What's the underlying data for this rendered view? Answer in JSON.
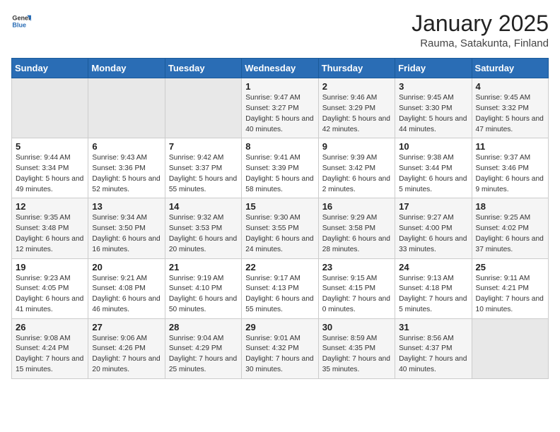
{
  "header": {
    "logo_general": "General",
    "logo_blue": "Blue",
    "title": "January 2025",
    "subtitle": "Rauma, Satakunta, Finland"
  },
  "weekdays": [
    "Sunday",
    "Monday",
    "Tuesday",
    "Wednesday",
    "Thursday",
    "Friday",
    "Saturday"
  ],
  "weeks": [
    [
      {
        "day": "",
        "sunrise": "",
        "sunset": "",
        "daylight": ""
      },
      {
        "day": "",
        "sunrise": "",
        "sunset": "",
        "daylight": ""
      },
      {
        "day": "",
        "sunrise": "",
        "sunset": "",
        "daylight": ""
      },
      {
        "day": "1",
        "sunrise": "Sunrise: 9:47 AM",
        "sunset": "Sunset: 3:27 PM",
        "daylight": "Daylight: 5 hours and 40 minutes."
      },
      {
        "day": "2",
        "sunrise": "Sunrise: 9:46 AM",
        "sunset": "Sunset: 3:29 PM",
        "daylight": "Daylight: 5 hours and 42 minutes."
      },
      {
        "day": "3",
        "sunrise": "Sunrise: 9:45 AM",
        "sunset": "Sunset: 3:30 PM",
        "daylight": "Daylight: 5 hours and 44 minutes."
      },
      {
        "day": "4",
        "sunrise": "Sunrise: 9:45 AM",
        "sunset": "Sunset: 3:32 PM",
        "daylight": "Daylight: 5 hours and 47 minutes."
      }
    ],
    [
      {
        "day": "5",
        "sunrise": "Sunrise: 9:44 AM",
        "sunset": "Sunset: 3:34 PM",
        "daylight": "Daylight: 5 hours and 49 minutes."
      },
      {
        "day": "6",
        "sunrise": "Sunrise: 9:43 AM",
        "sunset": "Sunset: 3:36 PM",
        "daylight": "Daylight: 5 hours and 52 minutes."
      },
      {
        "day": "7",
        "sunrise": "Sunrise: 9:42 AM",
        "sunset": "Sunset: 3:37 PM",
        "daylight": "Daylight: 5 hours and 55 minutes."
      },
      {
        "day": "8",
        "sunrise": "Sunrise: 9:41 AM",
        "sunset": "Sunset: 3:39 PM",
        "daylight": "Daylight: 5 hours and 58 minutes."
      },
      {
        "day": "9",
        "sunrise": "Sunrise: 9:39 AM",
        "sunset": "Sunset: 3:42 PM",
        "daylight": "Daylight: 6 hours and 2 minutes."
      },
      {
        "day": "10",
        "sunrise": "Sunrise: 9:38 AM",
        "sunset": "Sunset: 3:44 PM",
        "daylight": "Daylight: 6 hours and 5 minutes."
      },
      {
        "day": "11",
        "sunrise": "Sunrise: 9:37 AM",
        "sunset": "Sunset: 3:46 PM",
        "daylight": "Daylight: 6 hours and 9 minutes."
      }
    ],
    [
      {
        "day": "12",
        "sunrise": "Sunrise: 9:35 AM",
        "sunset": "Sunset: 3:48 PM",
        "daylight": "Daylight: 6 hours and 12 minutes."
      },
      {
        "day": "13",
        "sunrise": "Sunrise: 9:34 AM",
        "sunset": "Sunset: 3:50 PM",
        "daylight": "Daylight: 6 hours and 16 minutes."
      },
      {
        "day": "14",
        "sunrise": "Sunrise: 9:32 AM",
        "sunset": "Sunset: 3:53 PM",
        "daylight": "Daylight: 6 hours and 20 minutes."
      },
      {
        "day": "15",
        "sunrise": "Sunrise: 9:30 AM",
        "sunset": "Sunset: 3:55 PM",
        "daylight": "Daylight: 6 hours and 24 minutes."
      },
      {
        "day": "16",
        "sunrise": "Sunrise: 9:29 AM",
        "sunset": "Sunset: 3:58 PM",
        "daylight": "Daylight: 6 hours and 28 minutes."
      },
      {
        "day": "17",
        "sunrise": "Sunrise: 9:27 AM",
        "sunset": "Sunset: 4:00 PM",
        "daylight": "Daylight: 6 hours and 33 minutes."
      },
      {
        "day": "18",
        "sunrise": "Sunrise: 9:25 AM",
        "sunset": "Sunset: 4:02 PM",
        "daylight": "Daylight: 6 hours and 37 minutes."
      }
    ],
    [
      {
        "day": "19",
        "sunrise": "Sunrise: 9:23 AM",
        "sunset": "Sunset: 4:05 PM",
        "daylight": "Daylight: 6 hours and 41 minutes."
      },
      {
        "day": "20",
        "sunrise": "Sunrise: 9:21 AM",
        "sunset": "Sunset: 4:08 PM",
        "daylight": "Daylight: 6 hours and 46 minutes."
      },
      {
        "day": "21",
        "sunrise": "Sunrise: 9:19 AM",
        "sunset": "Sunset: 4:10 PM",
        "daylight": "Daylight: 6 hours and 50 minutes."
      },
      {
        "day": "22",
        "sunrise": "Sunrise: 9:17 AM",
        "sunset": "Sunset: 4:13 PM",
        "daylight": "Daylight: 6 hours and 55 minutes."
      },
      {
        "day": "23",
        "sunrise": "Sunrise: 9:15 AM",
        "sunset": "Sunset: 4:15 PM",
        "daylight": "Daylight: 7 hours and 0 minutes."
      },
      {
        "day": "24",
        "sunrise": "Sunrise: 9:13 AM",
        "sunset": "Sunset: 4:18 PM",
        "daylight": "Daylight: 7 hours and 5 minutes."
      },
      {
        "day": "25",
        "sunrise": "Sunrise: 9:11 AM",
        "sunset": "Sunset: 4:21 PM",
        "daylight": "Daylight: 7 hours and 10 minutes."
      }
    ],
    [
      {
        "day": "26",
        "sunrise": "Sunrise: 9:08 AM",
        "sunset": "Sunset: 4:24 PM",
        "daylight": "Daylight: 7 hours and 15 minutes."
      },
      {
        "day": "27",
        "sunrise": "Sunrise: 9:06 AM",
        "sunset": "Sunset: 4:26 PM",
        "daylight": "Daylight: 7 hours and 20 minutes."
      },
      {
        "day": "28",
        "sunrise": "Sunrise: 9:04 AM",
        "sunset": "Sunset: 4:29 PM",
        "daylight": "Daylight: 7 hours and 25 minutes."
      },
      {
        "day": "29",
        "sunrise": "Sunrise: 9:01 AM",
        "sunset": "Sunset: 4:32 PM",
        "daylight": "Daylight: 7 hours and 30 minutes."
      },
      {
        "day": "30",
        "sunrise": "Sunrise: 8:59 AM",
        "sunset": "Sunset: 4:35 PM",
        "daylight": "Daylight: 7 hours and 35 minutes."
      },
      {
        "day": "31",
        "sunrise": "Sunrise: 8:56 AM",
        "sunset": "Sunset: 4:37 PM",
        "daylight": "Daylight: 7 hours and 40 minutes."
      },
      {
        "day": "",
        "sunrise": "",
        "sunset": "",
        "daylight": ""
      }
    ]
  ]
}
